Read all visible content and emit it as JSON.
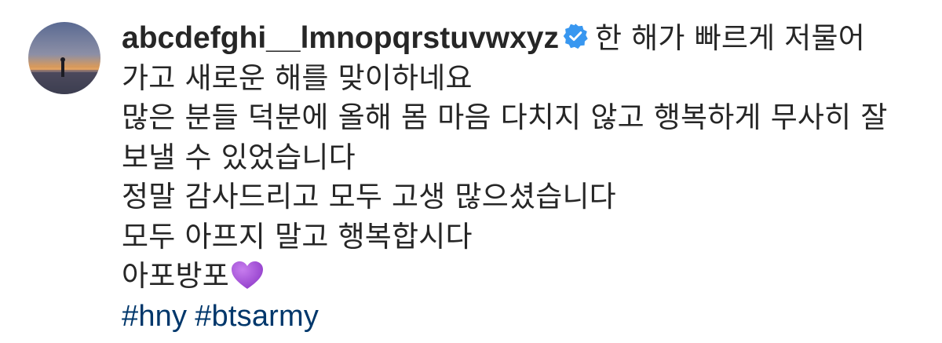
{
  "post": {
    "username": "abcdefghi__lmnopqrstuvwxyz",
    "verified": true,
    "verified_icon": "verified-badge-icon",
    "lines": {
      "l1": "한 해가 빠르게 저물어",
      "l2": "가고 새로운 해를 맞이하네요",
      "l3": "많은 분들 덕분에 올해 몸 마음 다치지 않고 행복하게 무사히 잘",
      "l4": "보낼 수 있었습니다",
      "l5": "정말 감사드리고 모두 고생 많으셨습니다",
      "l6": "모두 아프지 말고 행복합시다",
      "l7": "아포방포"
    },
    "emoji": "purple-heart-icon",
    "hashtags": [
      "#hny",
      "#btsarmy"
    ],
    "colors": {
      "text": "#262626",
      "hashtag": "#00376b",
      "verified": "#3897f0",
      "heart": "#a64dd6"
    }
  }
}
